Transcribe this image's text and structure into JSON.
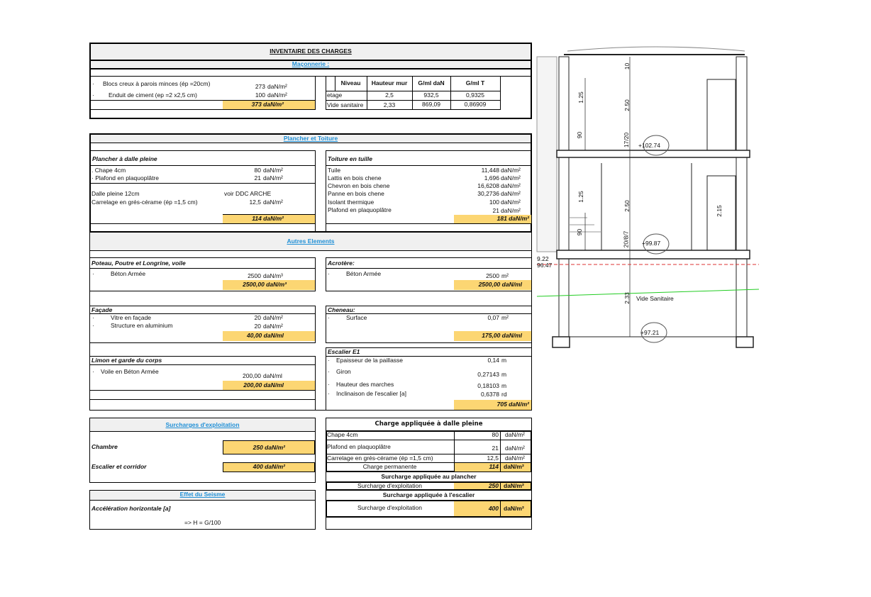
{
  "title": "INVENTAIRE DES CHARGES",
  "maconnerie": {
    "heading": "Maçonnerie :",
    "items": [
      {
        "label": "Blocs creux à parois minces  (ép =20cm)",
        "value": "273",
        "unit": "daN/m²"
      },
      {
        "label": "Enduit de ciment (ep =2 x2,5 cm)",
        "value": "100",
        "unit": "daN/m²"
      }
    ],
    "total": "373  daN/m²",
    "table": {
      "headers": [
        "Niveau",
        "Hauteur mur",
        "G/ml daN",
        "G/ml T"
      ],
      "rows": [
        [
          "etage",
          "2,5",
          "932,5",
          "0,9325"
        ],
        [
          "Vide sanitaire",
          "2,33",
          "869,09",
          "0,86909"
        ]
      ]
    }
  },
  "plancher_toiture": {
    "heading": "Plancher et Toiture",
    "plancher": {
      "title": "Plancher à dalle pleine",
      "items": [
        {
          "label": ". Chape 4cm",
          "value": "80",
          "unit": "daN/m²"
        },
        {
          "label": "· Plafond en plaquoplâtre",
          "value": "21",
          "unit": "daN/m²"
        },
        {
          "label": "Dalle pleine 12cm",
          "value": "voir DDC ARCHE",
          "unit": ""
        },
        {
          "label": "Carrelage en grés-cérame (ép =1,5 cm)",
          "value": "12,5",
          "unit": "daN/m²"
        }
      ],
      "total": "114  daN/m²"
    },
    "toiture": {
      "title": "Toiture en tuille",
      "items": [
        {
          "label": "Tuile",
          "value": "11,448",
          "unit": "daN/m²"
        },
        {
          "label": "Lattis en bois chene",
          "value": "1,696",
          "unit": "daN/m²"
        },
        {
          "label": "Chevron en bois chene",
          "value": "16,6208",
          "unit": "daN/m²"
        },
        {
          "label": "Panne en bois chene",
          "value": "30,2736",
          "unit": "daN/m²"
        },
        {
          "label": "Isolant thermique",
          "value": "100",
          "unit": "daN/m²"
        },
        {
          "label": " Plafond en plaquoplâtre",
          "value": "21",
          "unit": "daN/m²"
        }
      ],
      "total": "181  daN/m²"
    }
  },
  "autres": {
    "heading": "Autres Elements ",
    "poteau": {
      "title": "Poteau, Poutre et Longrine, voile",
      "item": "Béton Armée",
      "value": "2500",
      "unit": "daN/m³",
      "total": "2500,00  daN/m³"
    },
    "acrotere": {
      "title": "Acrotère:",
      "item": "Béton Armée",
      "value": "2500",
      "unit": "m²",
      "total": "2500,00  daN/ml"
    },
    "facade": {
      "title": "Façade",
      "items": [
        {
          "label": "Vitre en façade",
          "value": "20",
          "unit": "daN/m²"
        },
        {
          "label": "Structure en aluminium",
          "value": "20",
          "unit": "daN/m²"
        }
      ],
      "total": "40,00  daN/ml"
    },
    "cheneau": {
      "title": "Cheneau:",
      "item": "Surface",
      "value": "0,07",
      "unit": "m²",
      "total": "175,00  daN/ml"
    },
    "limon": {
      "title": "Limon et garde du corps",
      "item": "Voile en Béton Armée",
      "value": "200,00",
      "unit": "daN/ml",
      "total": "200,00  daN/ml"
    },
    "escalier": {
      "title": "Escalier E1",
      "items": [
        {
          "label": "Epaisseur de la paillasse",
          "value": "0,14",
          "unit": "m"
        },
        {
          "label": "Giron",
          "value": "0,27143",
          "unit": "m"
        },
        {
          "label": "Hauteur des marches",
          "value": "0,18103",
          "unit": "m"
        },
        {
          "label": " Inclinaison de l'escalier [a]",
          "value": "0,6378",
          "unit": "rd"
        }
      ],
      "total": "705  daN/m²"
    }
  },
  "surcharges": {
    "heading": "Surcharges d'exploitation",
    "chambre": "Chambre",
    "chambre_val": "250  daN/m²",
    "escalier": "Escalier et corridor",
    "escalier_val": "400  daN/m²"
  },
  "seisme": {
    "heading": "Effet du Seisme",
    "label": "Accélération horizontale [a]",
    "formula": "=> H = G/100"
  },
  "charge_dalle": {
    "title": "Charge appliquée à dalle pleine",
    "rows": [
      {
        "label": "Chape 4cm",
        "value": "80",
        "unit": "daN/m²"
      },
      {
        "label": "Plafond en plaquoplâtre",
        "value": "21",
        "unit": "daN/m²"
      },
      {
        "label": "Carrelage en grés-cérame (ép =1,5 cm)",
        "value": "12,5",
        "unit": "daN/m²"
      }
    ],
    "perm": {
      "label": "Charge permanente",
      "value": "114",
      "unit": "daN/m²"
    },
    "plancher_title": "Surcharge appliquée au plancher",
    "plancher": {
      "label": "Surcharge d'exploitation",
      "value": "250",
      "unit": "daN/m²"
    },
    "escalier_title": "Surcharge appliquée à l'escalier",
    "escalier": {
      "label": "Surcharge d'exploitation",
      "value": "400",
      "unit": "daN/m²"
    }
  },
  "drawing": {
    "dims": [
      "10",
      "1.25",
      "2.50",
      "90",
      "17/20",
      "1.25",
      "2.50",
      "90",
      "20/8/7",
      "2.15",
      "2.33"
    ],
    "levels": [
      "+102.74",
      "+99.87",
      "+97.21",
      "9.22",
      "96.47"
    ],
    "room": "Vide Sanitaire"
  },
  "colors": {
    "highlight": "#fcd673",
    "link": "#1f8fd6"
  }
}
